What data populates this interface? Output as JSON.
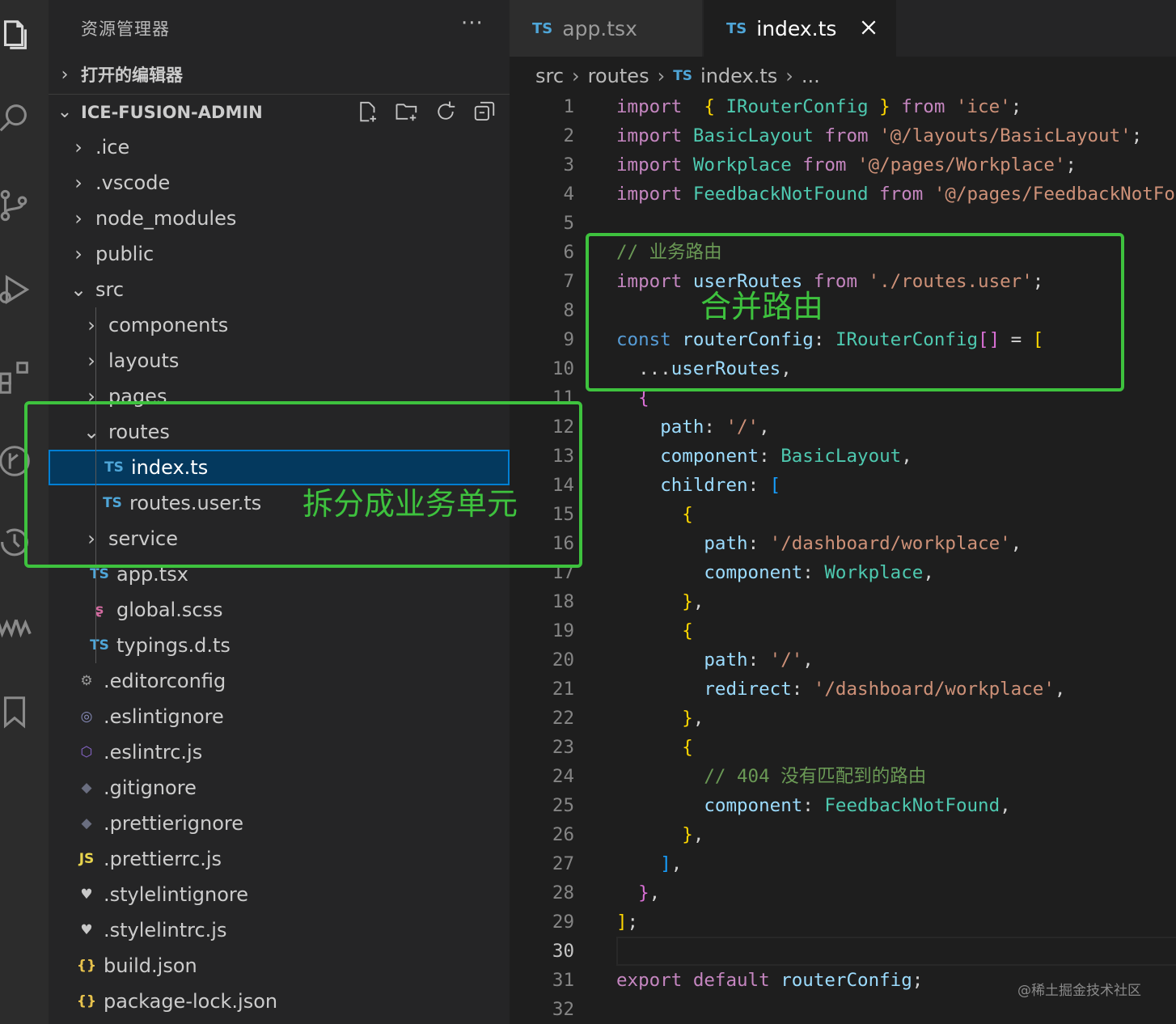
{
  "sidebar": {
    "title": "资源管理器",
    "more": "···",
    "open_editors": "打开的编辑器",
    "project": "ICE-FUSION-ADMIN",
    "tree": [
      {
        "label": ".ice",
        "chev": "›",
        "icon": ""
      },
      {
        "label": ".vscode",
        "chev": "›",
        "icon": ""
      },
      {
        "label": "node_modules",
        "chev": "›",
        "icon": ""
      },
      {
        "label": "public",
        "chev": "›",
        "icon": ""
      },
      {
        "label": "src",
        "chev": "⌄",
        "icon": ""
      },
      {
        "label": "components",
        "chev": "›",
        "icon": ""
      },
      {
        "label": "layouts",
        "chev": "›",
        "icon": ""
      },
      {
        "label": "pages",
        "chev": "›",
        "icon": ""
      },
      {
        "label": "routes",
        "chev": "⌄",
        "icon": ""
      },
      {
        "label": "index.ts",
        "chev": "",
        "icon": "TS"
      },
      {
        "label": "routes.user.ts",
        "chev": "",
        "icon": "TS"
      },
      {
        "label": "service",
        "chev": "›",
        "icon": ""
      },
      {
        "label": "app.tsx",
        "chev": "",
        "icon": "TS"
      },
      {
        "label": "global.scss",
        "chev": "",
        "icon": "ʂ"
      },
      {
        "label": "typings.d.ts",
        "chev": "",
        "icon": "TS"
      },
      {
        "label": ".editorconfig",
        "chev": "",
        "icon": "⚙"
      },
      {
        "label": ".eslintignore",
        "chev": "",
        "icon": "◎"
      },
      {
        "label": ".eslintrc.js",
        "chev": "",
        "icon": "⬡"
      },
      {
        "label": ".gitignore",
        "chev": "",
        "icon": "◆"
      },
      {
        "label": ".prettierignore",
        "chev": "",
        "icon": "◆"
      },
      {
        "label": ".prettierrc.js",
        "chev": "",
        "icon": "JS"
      },
      {
        "label": ".stylelintignore",
        "chev": "",
        "icon": "♥"
      },
      {
        "label": ".stylelintrc.js",
        "chev": "",
        "icon": "♥"
      },
      {
        "label": "build.json",
        "chev": "",
        "icon": "{}"
      },
      {
        "label": "package-lock.json",
        "chev": "",
        "icon": "{}"
      }
    ]
  },
  "tabs": [
    {
      "icon": "TS",
      "label": "app.tsx"
    },
    {
      "icon": "TS",
      "label": "index.ts"
    }
  ],
  "breadcrumb": {
    "parts": [
      "src",
      "routes",
      "index.ts",
      "..."
    ],
    "file_icon": "TS"
  },
  "editor": {
    "line_numbers": [
      "1",
      "2",
      "3",
      "4",
      "5",
      "6",
      "7",
      "8",
      "9",
      "10",
      "11",
      "12",
      "13",
      "14",
      "15",
      "16",
      "17",
      "18",
      "19",
      "20",
      "21",
      "22",
      "23",
      "24",
      "25",
      "26",
      "27",
      "28",
      "29",
      "30",
      "31",
      "32"
    ],
    "active_line": "30",
    "lines": [
      [
        [
          "kw",
          "import"
        ],
        [
          "",
          "  "
        ],
        [
          "b1",
          "{"
        ],
        [
          "",
          " "
        ],
        [
          "ty",
          "IRouterConfig"
        ],
        [
          "",
          " "
        ],
        [
          "b1",
          "}"
        ],
        [
          "",
          " "
        ],
        [
          "kw",
          "from"
        ],
        [
          "",
          " "
        ],
        [
          "st",
          "'ice'"
        ],
        [
          "",
          ";"
        ]
      ],
      [
        [
          "kw",
          "import"
        ],
        [
          "",
          " "
        ],
        [
          "ty",
          "BasicLayout"
        ],
        [
          "",
          " "
        ],
        [
          "kw",
          "from"
        ],
        [
          "",
          " "
        ],
        [
          "st",
          "'@/layouts/BasicLayout'"
        ],
        [
          "",
          ";"
        ]
      ],
      [
        [
          "kw",
          "import"
        ],
        [
          "",
          " "
        ],
        [
          "ty",
          "Workplace"
        ],
        [
          "",
          " "
        ],
        [
          "kw",
          "from"
        ],
        [
          "",
          " "
        ],
        [
          "st",
          "'@/pages/Workplace'"
        ],
        [
          "",
          ";"
        ]
      ],
      [
        [
          "kw",
          "import"
        ],
        [
          "",
          " "
        ],
        [
          "ty",
          "FeedbackNotFound"
        ],
        [
          "",
          " "
        ],
        [
          "kw",
          "from"
        ],
        [
          "",
          " "
        ],
        [
          "st",
          "'@/pages/FeedbackNotFound'"
        ],
        [
          "",
          ";"
        ]
      ],
      [],
      [
        [
          "cm",
          "// 业务路由"
        ]
      ],
      [
        [
          "kw",
          "import"
        ],
        [
          "",
          " "
        ],
        [
          "vr",
          "userRoutes"
        ],
        [
          "",
          " "
        ],
        [
          "kw",
          "from"
        ],
        [
          "",
          " "
        ],
        [
          "st",
          "'./routes.user'"
        ],
        [
          "",
          ";"
        ]
      ],
      [],
      [
        [
          "kb",
          "const"
        ],
        [
          "",
          " "
        ],
        [
          "vr",
          "routerConfig"
        ],
        [
          "",
          ": "
        ],
        [
          "ty",
          "IRouterConfig"
        ],
        [
          "b2",
          "[]"
        ],
        [
          "",
          " = "
        ],
        [
          "b1",
          "["
        ]
      ],
      [
        [
          "",
          "  ..."
        ],
        [
          "vr",
          "userRoutes"
        ],
        [
          "",
          ","
        ]
      ],
      [
        [
          "",
          "  "
        ],
        [
          "b2",
          "{"
        ]
      ],
      [
        [
          "",
          "    "
        ],
        [
          "pr",
          "path"
        ],
        [
          "",
          ": "
        ],
        [
          "st",
          "'/'"
        ],
        [
          "",
          ","
        ]
      ],
      [
        [
          "",
          "    "
        ],
        [
          "pr",
          "component"
        ],
        [
          "",
          ": "
        ],
        [
          "ty",
          "BasicLayout"
        ],
        [
          "",
          ","
        ]
      ],
      [
        [
          "",
          "    "
        ],
        [
          "pr",
          "children"
        ],
        [
          "",
          ": "
        ],
        [
          "b3",
          "["
        ]
      ],
      [
        [
          "",
          "      "
        ],
        [
          "b1",
          "{"
        ]
      ],
      [
        [
          "",
          "        "
        ],
        [
          "pr",
          "path"
        ],
        [
          "",
          ": "
        ],
        [
          "st",
          "'/dashboard/workplace'"
        ],
        [
          "",
          ","
        ]
      ],
      [
        [
          "",
          "        "
        ],
        [
          "pr",
          "component"
        ],
        [
          "",
          ": "
        ],
        [
          "ty",
          "Workplace"
        ],
        [
          "",
          ","
        ]
      ],
      [
        [
          "",
          "      "
        ],
        [
          "b1",
          "}"
        ],
        [
          "",
          ","
        ]
      ],
      [
        [
          "",
          "      "
        ],
        [
          "b1",
          "{"
        ]
      ],
      [
        [
          "",
          "        "
        ],
        [
          "pr",
          "path"
        ],
        [
          "",
          ": "
        ],
        [
          "st",
          "'/'"
        ],
        [
          "",
          ","
        ]
      ],
      [
        [
          "",
          "        "
        ],
        [
          "pr",
          "redirect"
        ],
        [
          "",
          ": "
        ],
        [
          "st",
          "'/dashboard/workplace'"
        ],
        [
          "",
          ","
        ]
      ],
      [
        [
          "",
          "      "
        ],
        [
          "b1",
          "}"
        ],
        [
          "",
          ","
        ]
      ],
      [
        [
          "",
          "      "
        ],
        [
          "b1",
          "{"
        ]
      ],
      [
        [
          "",
          "        "
        ],
        [
          "cm",
          "// 404 没有匹配到的路由"
        ]
      ],
      [
        [
          "",
          "        "
        ],
        [
          "pr",
          "component"
        ],
        [
          "",
          ": "
        ],
        [
          "ty",
          "FeedbackNotFound"
        ],
        [
          "",
          ","
        ]
      ],
      [
        [
          "",
          "      "
        ],
        [
          "b1",
          "}"
        ],
        [
          "",
          ","
        ]
      ],
      [
        [
          "",
          "    "
        ],
        [
          "b3",
          "]"
        ],
        [
          "",
          ","
        ]
      ],
      [
        [
          "",
          "  "
        ],
        [
          "b2",
          "}"
        ],
        [
          "",
          ","
        ]
      ],
      [
        [
          "b1",
          "]"
        ],
        [
          "",
          ";"
        ]
      ],
      [],
      [
        [
          "kw",
          "export"
        ],
        [
          "",
          " "
        ],
        [
          "kw",
          "default"
        ],
        [
          "",
          " "
        ],
        [
          "vr",
          "routerConfig"
        ],
        [
          "",
          ";"
        ]
      ],
      []
    ]
  },
  "annotations": {
    "merge": "合并路由",
    "split": "拆分成业务单元"
  },
  "watermark": "@稀土掘金技术社区",
  "colors": {
    "annotation": "#3ec23e",
    "selection": "#04395e",
    "ts_icon": "#4fa6d8"
  }
}
